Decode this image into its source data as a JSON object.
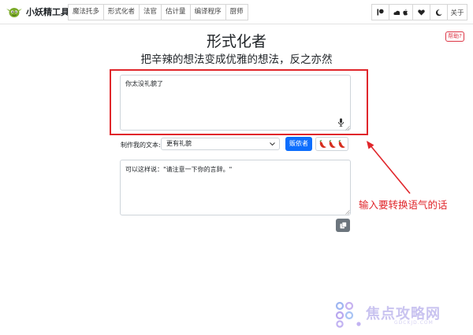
{
  "brand": {
    "name": "小妖精工具",
    "logo_icon": "goblin-logo-icon"
  },
  "nav": {
    "tabs": [
      "魔法托多",
      "形式化者",
      "法官",
      "估计量",
      "编译程序",
      "厨师"
    ],
    "right": {
      "about_label": "关于",
      "icons": [
        "patreon-icon",
        "cloud-apple-icon",
        "heart-icon",
        "moon-icon"
      ]
    }
  },
  "page": {
    "title": "形式化者",
    "subtitle": "把辛辣的想法变成优雅的想法，反之亦然",
    "help_label": "帮助?"
  },
  "input": {
    "value": "你太没礼貌了",
    "mic_icon": "microphone-icon"
  },
  "controls": {
    "label": "制作我的文本:",
    "selected_option": "更有礼貌",
    "submit_label": "贩依者",
    "spice_icons": [
      "chili-pepper-icon",
      "chili-pepper-icon",
      "chili-pepper-icon"
    ]
  },
  "output": {
    "text": "可以这样说：\"请注意一下你的言辞。\"",
    "copy_icon": "copy-icon"
  },
  "annotation": {
    "text": "输入要转换语气的话",
    "color": "#e0262b"
  },
  "watermark": {
    "text": "焦点攻略网",
    "sub": "GDCKJD.COM"
  },
  "colors": {
    "primary": "#0d6efd",
    "annotation": "#e0262b",
    "secondary": "#6c757d"
  }
}
